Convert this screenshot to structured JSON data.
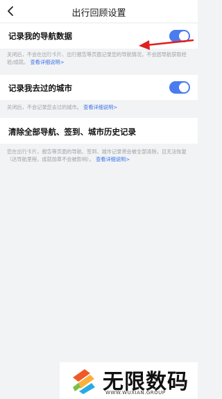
{
  "header": {
    "title": "出行回顾设置",
    "back_icon": "chevron-left-icon"
  },
  "settings": [
    {
      "label": "记录我的导航数据",
      "enabled": true,
      "description": "关闭后，不会在出行卡片、出行报告等页面记录您的导航情况，不会因导航获取经验/成就。",
      "link": "查看详细说明>"
    },
    {
      "label": "记录我去过的城市",
      "enabled": true,
      "description": "关闭后，不会记录您去过的城市。",
      "link": "查看详细说明>"
    }
  ],
  "clear": {
    "label": "清除全部导航、签到、城市历史记录",
    "description": "您在出行卡片，报告等页面的导航、签到、城市记录将会被全部清除，且无法恢复（达导航里程，成就勋章不会被影响）。",
    "link": "查看详细说明>"
  },
  "colors": {
    "accent": "#4a7cf0",
    "annotation_arrow": "#e02020"
  },
  "watermark": {
    "name": "无限数码",
    "url": "WWW.WUXIAN.GROUP"
  }
}
